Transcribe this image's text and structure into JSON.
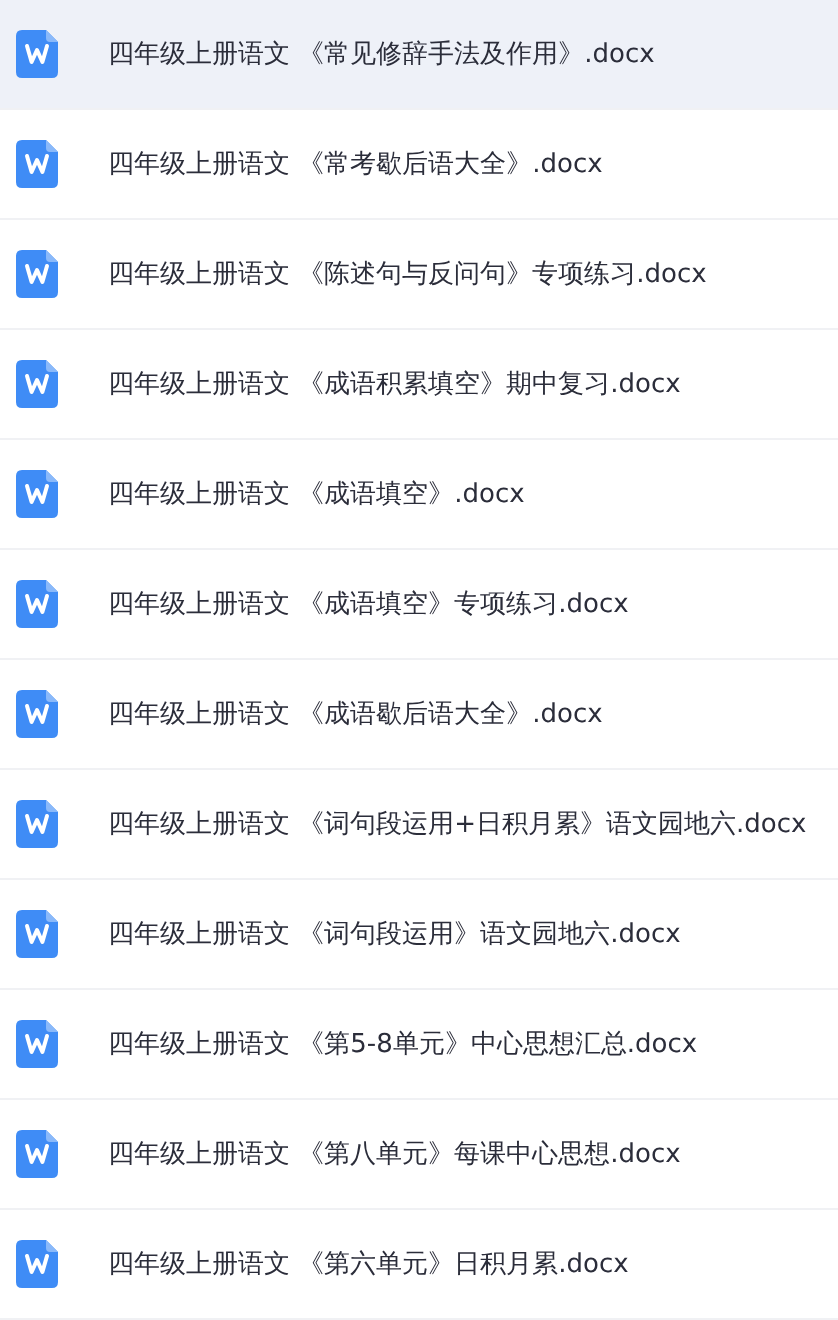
{
  "files": [
    {
      "name": "四年级上册语文 《常见修辞手法及作用》.docx",
      "selected": true
    },
    {
      "name": "四年级上册语文 《常考歇后语大全》.docx",
      "selected": false
    },
    {
      "name": "四年级上册语文 《陈述句与反问句》专项练习.docx",
      "selected": false
    },
    {
      "name": "四年级上册语文 《成语积累填空》期中复习.docx",
      "selected": false
    },
    {
      "name": "四年级上册语文 《成语填空》.docx",
      "selected": false
    },
    {
      "name": "四年级上册语文 《成语填空》专项练习.docx",
      "selected": false
    },
    {
      "name": "四年级上册语文 《成语歇后语大全》.docx",
      "selected": false
    },
    {
      "name": "四年级上册语文 《词句段运用+日积月累》语文园地六.docx",
      "selected": false
    },
    {
      "name": "四年级上册语文 《词句段运用》语文园地六.docx",
      "selected": false
    },
    {
      "name": "四年级上册语文 《第5-8单元》中心思想汇总.docx",
      "selected": false
    },
    {
      "name": "四年级上册语文 《第八单元》每课中心思想.docx",
      "selected": false
    },
    {
      "name": "四年级上册语文 《第六单元》日积月累.docx",
      "selected": false
    }
  ]
}
